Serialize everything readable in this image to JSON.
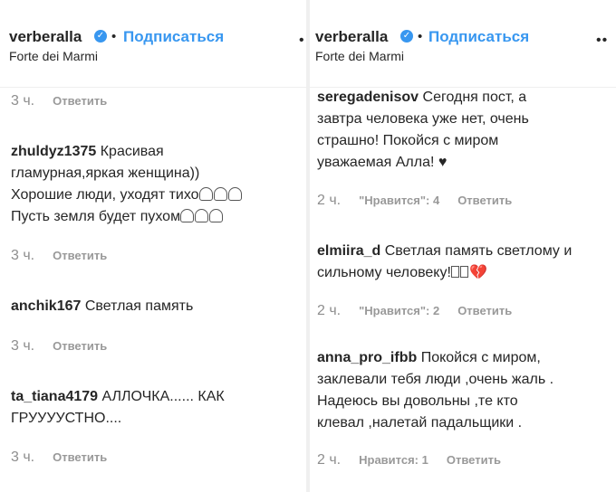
{
  "left": {
    "header": {
      "username": "verberalla",
      "bullet": "•",
      "follow": "Подписаться",
      "location": "Forte dei Marmi",
      "more": "•"
    },
    "top_meta": {
      "time": "3 ч.",
      "reply": "Ответить"
    },
    "comments": [
      {
        "user": "zhuldyz1375",
        "lines": [
          "Красивая",
          "гламурная,яркая женщина))",
          "Хорошие люди, уходят тихо",
          "Пусть земля будет пухом"
        ],
        "time": "3 ч.",
        "reply": "Ответить"
      },
      {
        "user": "anchik167",
        "lines": [
          "Светлая память"
        ],
        "time": "3 ч.",
        "reply": "Ответить"
      },
      {
        "user": "ta_tiana4179",
        "lines": [
          "АЛЛОЧКА...... КАК",
          "ГРУУУУСТНО...."
        ],
        "time": "3 ч.",
        "reply": "Ответить"
      }
    ]
  },
  "right": {
    "header": {
      "username": "verberalla",
      "bullet": "•",
      "follow": "Подписаться",
      "location": "Forte dei Marmi",
      "more": "••"
    },
    "comments": [
      {
        "user": "seregadenisov",
        "lines": [
          "Сегодня пост, а",
          "завтра человека уже нет, очень",
          "страшно! Покойся с миром",
          "уважаемая Алла! ♥"
        ],
        "time": "2 ч.",
        "likes": "\"Нравится\": 4",
        "reply": "Ответить"
      },
      {
        "user": "elmiira_d",
        "lines": [
          "Светлая память светлому и",
          "сильному человеку!"
        ],
        "heart": "💔",
        "time": "2 ч.",
        "likes": "\"Нравится\": 2",
        "reply": "Ответить"
      },
      {
        "user": "anna_pro_ifbb",
        "lines": [
          "Покойся с миром,",
          "заклевали тебя люди ,очень жаль .",
          "Надеюсь вы довольны ,те кто",
          "клевал ,налетай падальщики ."
        ],
        "time": "2 ч.",
        "likes": "Нравится: 1",
        "reply": "Ответить"
      }
    ]
  }
}
